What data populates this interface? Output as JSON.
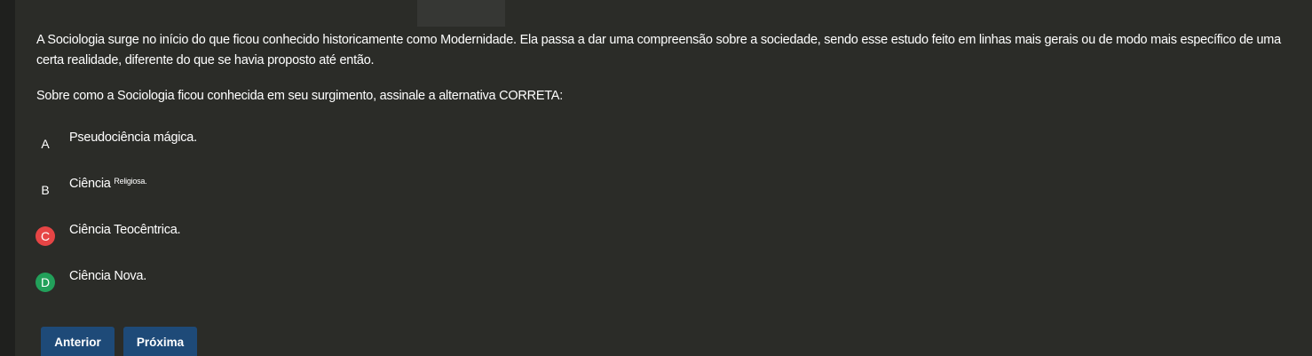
{
  "question": {
    "text": "A Sociologia surge no início do que ficou conhecido historicamente como Modernidade. Ela passa a dar uma compreensão sobre a sociedade, sendo esse estudo feito em linhas mais gerais ou de modo mais específico de uma certa realidade, diferente do que se havia proposto até então.",
    "prompt": "Sobre como a Sociologia ficou conhecida em seu surgimento, assinale a alternativa CORRETA:"
  },
  "options": [
    {
      "letter": "A",
      "text": "Pseudociência mágica.",
      "status": "none"
    },
    {
      "letter": "B",
      "text": "Ciência",
      "superscript": "Religiosa.",
      "status": "none"
    },
    {
      "letter": "C",
      "text": "Ciência Teocêntrica.",
      "status": "wrong"
    },
    {
      "letter": "D",
      "text": "Ciência Nova.",
      "status": "correct"
    }
  ],
  "navigation": {
    "previous_label": "Anterior",
    "next_label": "Próxima"
  },
  "colors": {
    "wrong": "#e64545",
    "correct": "#22a05a",
    "button": "#1e4a78",
    "background": "#2b2c28"
  }
}
